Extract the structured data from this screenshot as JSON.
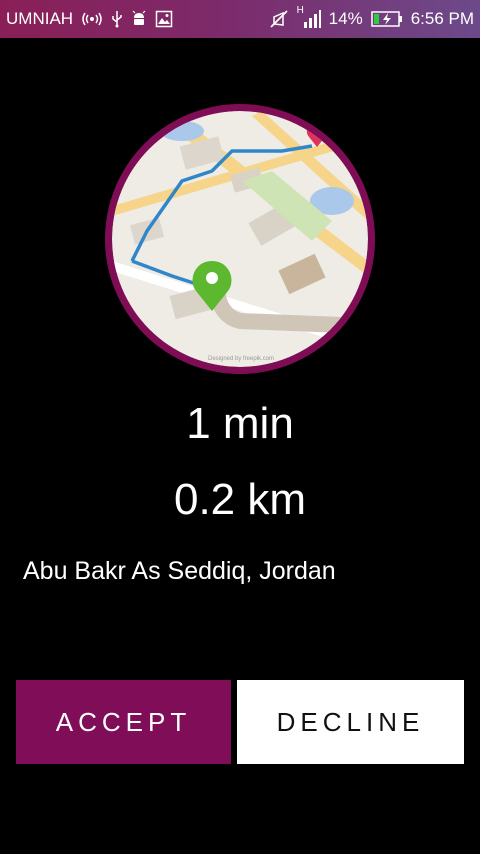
{
  "status_bar": {
    "carrier": "UMNIAH",
    "network_type": "H",
    "battery": "14%",
    "time": "6:56 PM",
    "icons": [
      "hotspot-icon",
      "usb-icon",
      "android-debug-icon",
      "image-icon",
      "mute-icon",
      "signal-icon",
      "battery-charging-icon"
    ]
  },
  "trip": {
    "eta": "1 min",
    "distance": "0.2 km",
    "address": "Abu Bakr As Seddiq, Jordan"
  },
  "map": {
    "credit": "Designed by freepik.com",
    "icons": [
      "location-pin-icon",
      "destination-pin-icon"
    ]
  },
  "actions": {
    "accept_label": "ACCEPT",
    "decline_label": "DECLINE"
  },
  "colors": {
    "accent": "#800d58",
    "background": "#000000",
    "decline_bg": "#ffffff"
  }
}
